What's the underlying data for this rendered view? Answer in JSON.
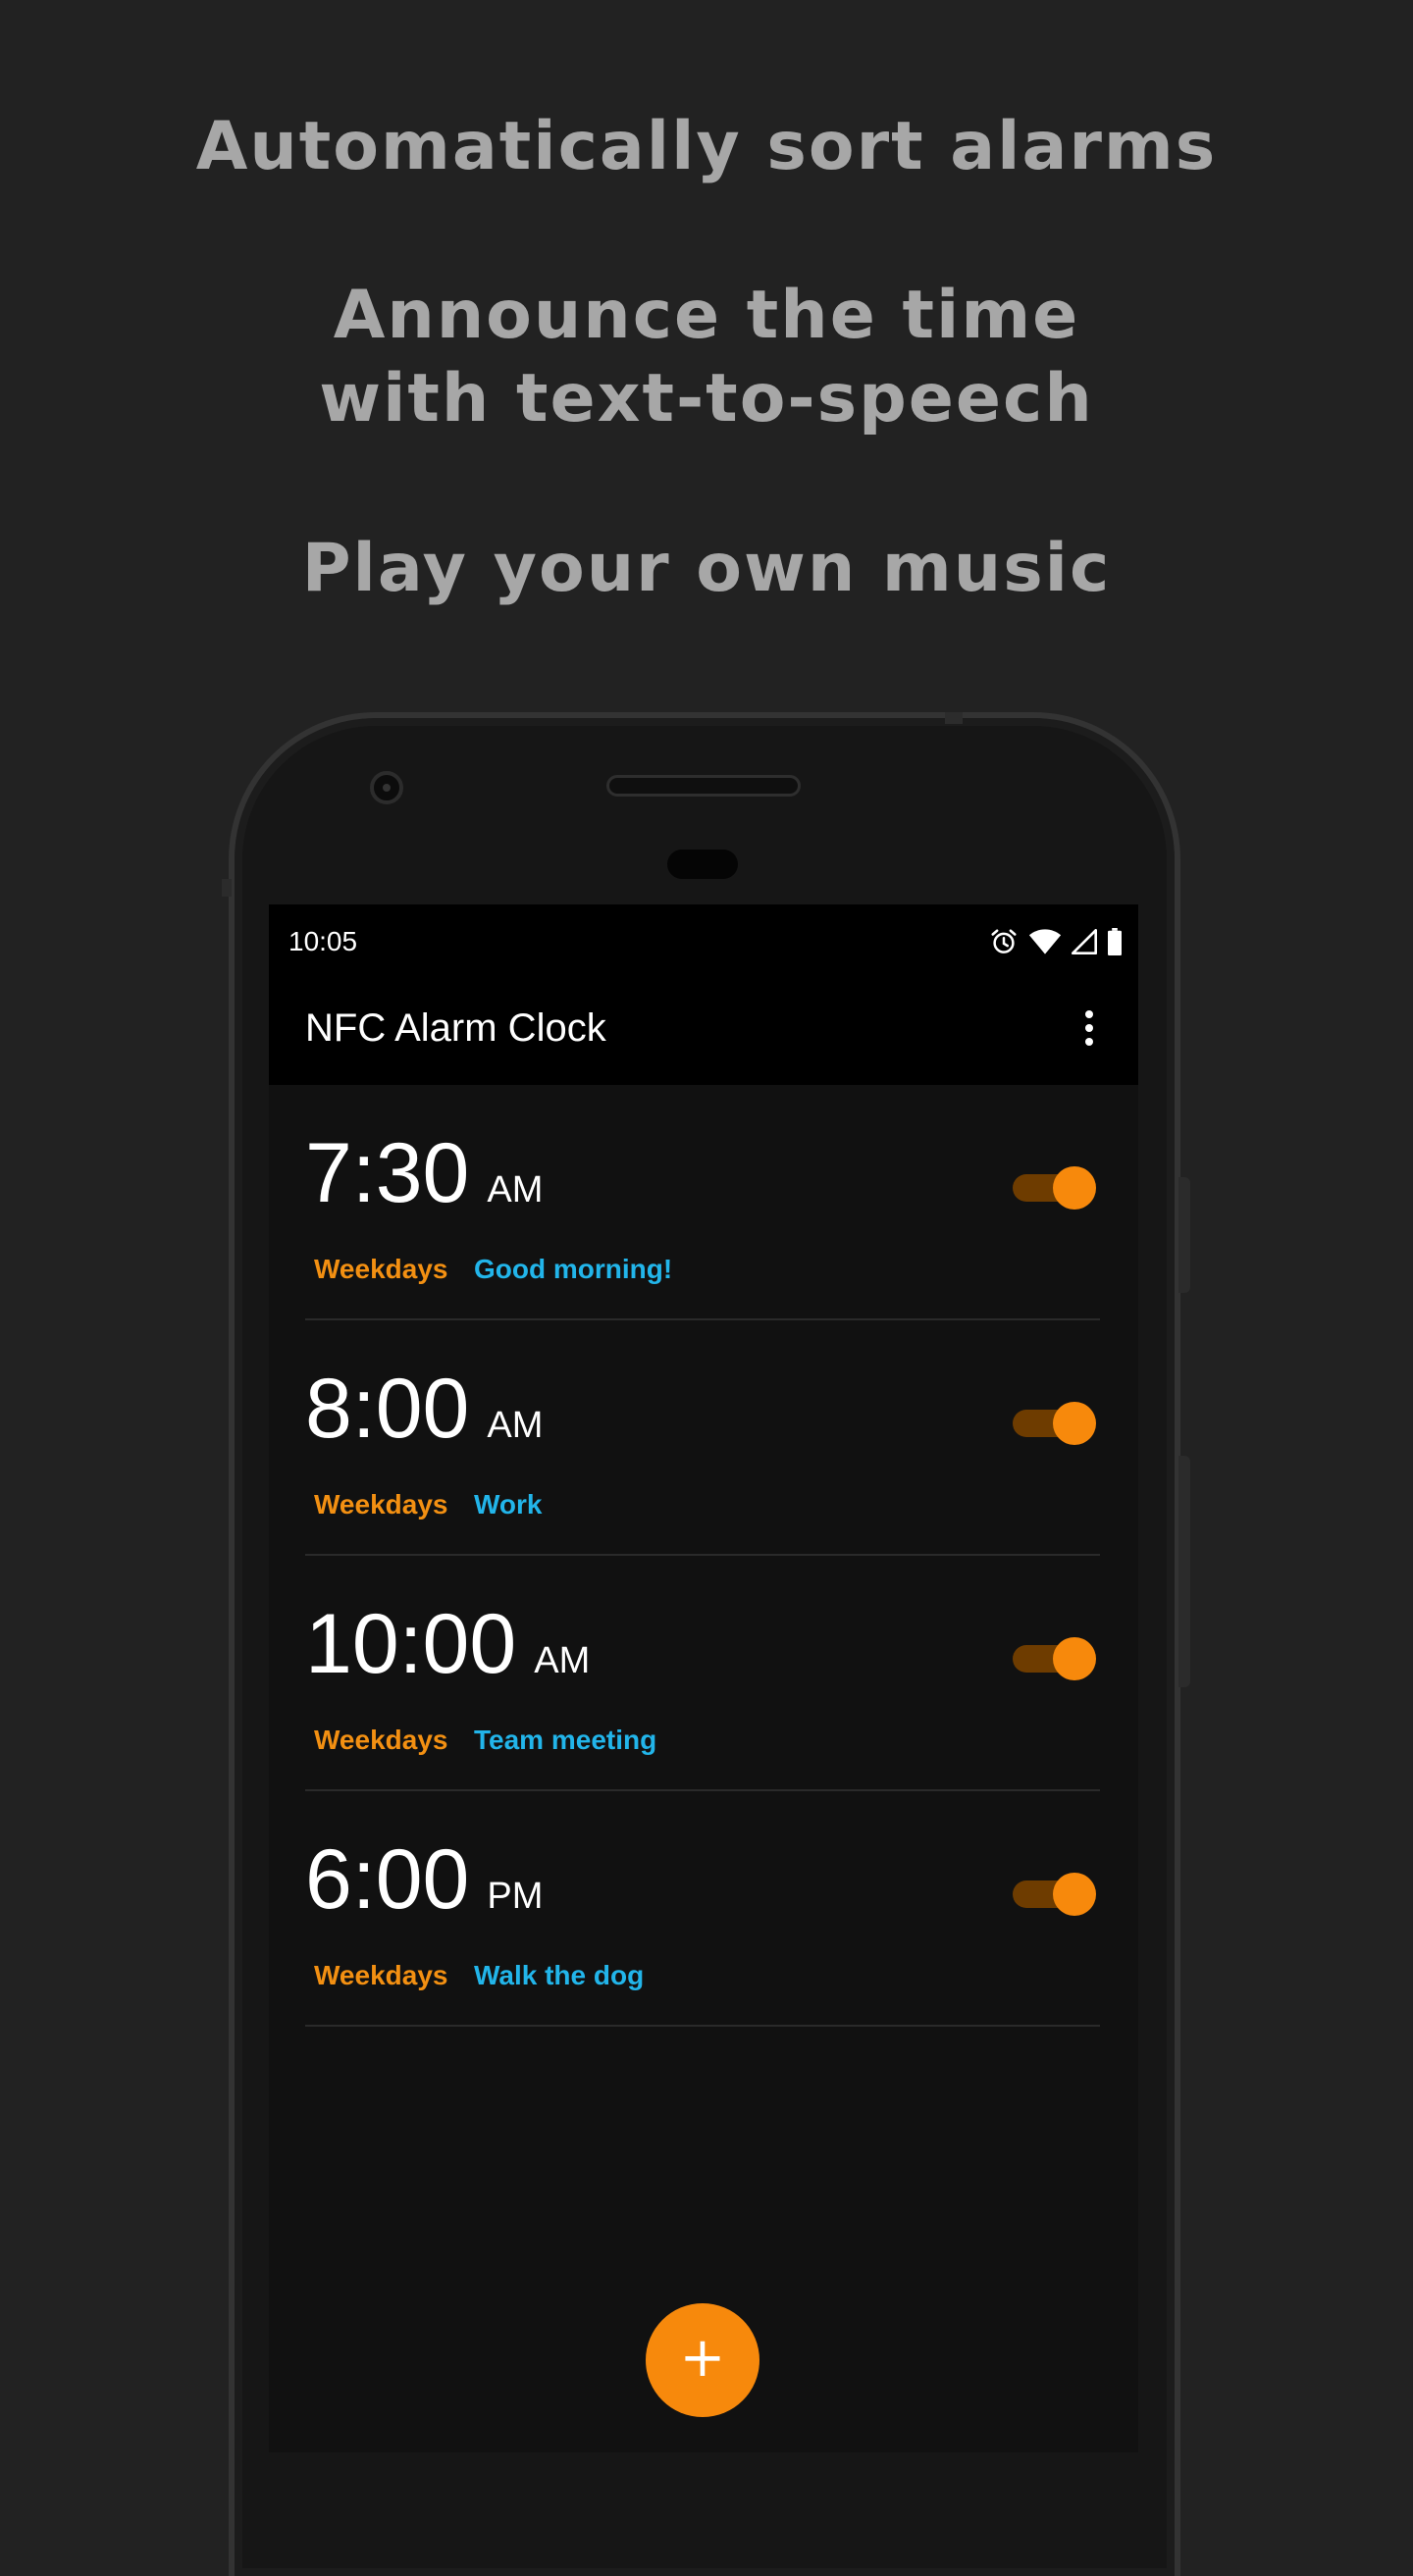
{
  "promo": {
    "line1": "Automatically sort alarms",
    "line2": "Announce the time",
    "line3": "with text-to-speech",
    "line4": "Play your own music"
  },
  "status_bar": {
    "time": "10:05",
    "icons": [
      "alarm-icon",
      "wifi-icon",
      "cell-signal-icon",
      "battery-icon"
    ]
  },
  "app_bar": {
    "title": "NFC Alarm Clock",
    "menu_icon": "overflow-menu-icon"
  },
  "alarms": [
    {
      "time": "7:30",
      "ampm": "AM",
      "days": "Weekdays",
      "label": "Good morning!",
      "enabled": true
    },
    {
      "time": "8:00",
      "ampm": "AM",
      "days": "Weekdays",
      "label": "Work",
      "enabled": true
    },
    {
      "time": "10:00",
      "ampm": "AM",
      "days": "Weekdays",
      "label": "Team meeting",
      "enabled": true
    },
    {
      "time": "6:00",
      "ampm": "PM",
      "days": "Weekdays",
      "label": "Walk the dog",
      "enabled": true
    }
  ],
  "fab": {
    "label": "+",
    "icon": "add-icon"
  },
  "colors": {
    "accent": "#f7890c",
    "days_text": "#f39012",
    "label_text": "#22b5ea",
    "background": "#222222",
    "screen_bg": "#111111"
  }
}
